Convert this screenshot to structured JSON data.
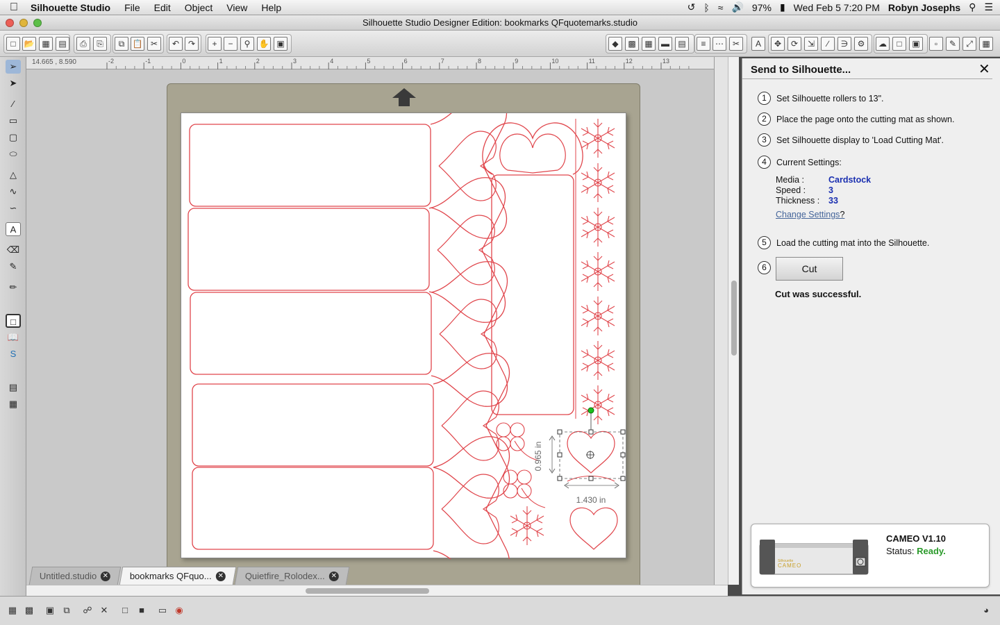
{
  "menubar": {
    "apple": "",
    "app_name": "Silhouette Studio",
    "items": [
      "File",
      "Edit",
      "Object",
      "View",
      "Help"
    ],
    "battery": "97%",
    "datetime": "Wed Feb 5  7:20 PM",
    "user": "Robyn Josephs"
  },
  "window": {
    "title": "Silhouette Studio Designer Edition: bookmarks QFquotemarks.studio"
  },
  "canvas": {
    "coordinates": "14.665 , 8.590",
    "ruler_top_labels": [
      "-2",
      "-1",
      "0",
      "1",
      "2",
      "3",
      "4",
      "5",
      "6",
      "7",
      "8",
      "9",
      "10",
      "11",
      "12",
      "13"
    ],
    "dimension_height": "0.965 in",
    "dimension_width": "1.430 in"
  },
  "tabs": [
    {
      "label": "Untitled.studio",
      "active": false
    },
    {
      "label": "bookmarks QFquo...",
      "active": true
    },
    {
      "label": "Quietfire_Rolodex...",
      "active": false
    }
  ],
  "send_panel": {
    "title": "Send to Silhouette...",
    "steps": {
      "s1": {
        "num": "1",
        "text": "Set Silhouette rollers to 13\"."
      },
      "s2": {
        "num": "2",
        "text": "Place the page onto the cutting mat as shown."
      },
      "s3": {
        "num": "3",
        "text": "Set Silhouette display to 'Load Cutting Mat'."
      },
      "s4": {
        "num": "4",
        "text": "Current Settings:"
      },
      "s5": {
        "num": "5",
        "text": "Load the cutting mat into the Silhouette."
      },
      "s6": {
        "num": "6"
      }
    },
    "settings": {
      "media_label": "Media :",
      "media_value": "Cardstock",
      "speed_label": "Speed :",
      "speed_value": "3",
      "thickness_label": "Thickness :",
      "thickness_value": "33"
    },
    "change_settings": "Change Settings",
    "change_settings_suffix": "?",
    "cut_label": "Cut",
    "cut_status": "Cut was successful.",
    "device": {
      "name": "CAMEO V1.10",
      "status_label": "Status:",
      "status_value": "Ready.",
      "brand_small": "Silhouette",
      "brand_big": "CAMEO"
    }
  },
  "colors": {
    "cut_line": "#e0454b",
    "ready": "#2a9a2a",
    "setting_value": "#1a2fb0"
  }
}
